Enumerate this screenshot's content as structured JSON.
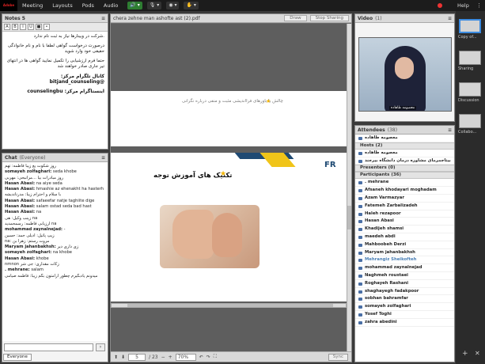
{
  "topbar": {
    "logo": "Adobe",
    "menus": [
      "Meeting",
      "Layouts",
      "Pods",
      "Audio"
    ],
    "help": "Help",
    "more": "⋮"
  },
  "notes": {
    "title": "Notes 5",
    "lines": [
      {
        "text": ".شرکت در وبینارها نیاز به ثبت نام ندارد",
        "bold": false
      },
      {
        "text": "درصورت درخواست گواهی لطفا با نام و نام خانوادگی حقیقی خود وارد شوید",
        "bold": false
      },
      {
        "text": "حتما فرم ارزشیابی را تکمیل نمایید گواهی ها در انتهای تیر جاری صادر خواهند شد",
        "bold": false
      },
      {
        "text": "کانال تلگرام مرکز: @bitjand_counseling",
        "bold": true
      },
      {
        "text": "اینستاگرام مرکز: counselingbu",
        "bold": true
      }
    ]
  },
  "chat": {
    "title": "Chat",
    "sub": "(Everyone)",
    "messages": [
      {
        "name": "",
        "text": "روز شکوت یع زیبا فاطمه: تهم"
      },
      {
        "name": "somayeh zolfaghari:",
        "text": "seda khobe"
      },
      {
        "name": "",
        "text": "روز مبادرات بیا ...مرانبحی: مهربی"
      },
      {
        "name": "Hasan Abasi:",
        "text": "na aiye seda"
      },
      {
        "name": "Hasan Abasi:",
        "text": "hmashie az ehenakht ha hasterh"
      },
      {
        "name": "",
        "text": "با سلام و احترام زیبا: مدرناندیشه"
      },
      {
        "name": "Hasan Abasi:",
        "text": "safaeefar natje taghiite dige"
      },
      {
        "name": "Hasan Abasi:",
        "text": "salam ostad seda bad hast"
      },
      {
        "name": "Hasan Abasi:",
        "text": "na"
      },
      {
        "name": "",
        "text": "زینب وکیل: هی na"
      },
      {
        "name": "",
        "text": "ارزیابی فاطمه: رسمحمدید na"
      },
      {
        "name": "mohammad zaynalnejad:",
        "text": "-"
      },
      {
        "name": "",
        "text": "زیپ پاتیل: ادیلی جمد: حسین"
      },
      {
        "name": "",
        "text": "na: مروت رستم: زهرا بن"
      },
      {
        "name": "Maryam jahanbakhsh:",
        "text": "زی داری دیر"
      },
      {
        "name": "somayeh zolfaghari:",
        "text": "na khobe"
      },
      {
        "name": "Hasan Abasi:",
        "text": "khobe"
      },
      {
        "name": "",
        "text": "nmnon زکات مقداری: جی شر"
      },
      {
        "name": ". mehrane:",
        "text": "salam"
      },
      {
        "name": "",
        "text": "میدونم یادبگیرم چطور آرامتون بگم زیبا: فاطمه صیامی"
      }
    ],
    "send": "›",
    "tab": "Everyone"
  },
  "share": {
    "title": "chera zehne man ashofte ast (2).pdf",
    "draw_label": "Draw",
    "stop_label": "Stop Sharing",
    "slide1_caption": "چالش با باورهای فرااندیشی مثبت و منفی درباره نگرانی",
    "slide2_title": "تکنیک های آموزش توجه",
    "slide2_logo": "FR",
    "page_current": "5",
    "page_total": "/ 23",
    "zoom": "70%",
    "sync": "Sync"
  },
  "video": {
    "title": "Video",
    "sub": "(1)",
    "caption": "معصومه طاهاده"
  },
  "attendees": {
    "title": "Attendees",
    "sub": "(38)",
    "active_speaker": "معصومه طاهاده",
    "hosts_label": "Hosts (2)",
    "hosts": [
      "معصومه طاهاده",
      "بیتاجمرمای مشاوره درمان دانشگاه بیرجند"
    ],
    "presenters_label": "Presenters (0)",
    "participants_label": "Participants (36)",
    "participants": [
      {
        "name": ". mehrane",
        "blue": false
      },
      {
        "name": "Afsaneh khodayari moghadam",
        "blue": false
      },
      {
        "name": "Azam Varmazyar",
        "blue": false
      },
      {
        "name": "Fatemeh Zarbalizadeh",
        "blue": false
      },
      {
        "name": "Haleh rezapoor",
        "blue": false
      },
      {
        "name": "Hasan Abasi",
        "blue": false
      },
      {
        "name": "Khadijeh shamsi",
        "blue": false
      },
      {
        "name": "maedeh abdi",
        "blue": false
      },
      {
        "name": "Mahboobeh Derzi",
        "blue": false
      },
      {
        "name": "Maryam jahanbakhsh",
        "blue": false
      },
      {
        "name": "Mehrangiz Sheikofteh",
        "blue": true
      },
      {
        "name": "mohammad zaynalnejad",
        "blue": false
      },
      {
        "name": "Naghmeh roustaei",
        "blue": false
      },
      {
        "name": "Roghayeh Rashani",
        "blue": false
      },
      {
        "name": "shaghayegh fadakpoor",
        "blue": false
      },
      {
        "name": "sobhan bahramfar",
        "blue": false
      },
      {
        "name": "somayeh zolfaghari",
        "blue": false
      },
      {
        "name": "Yosef Toghi",
        "blue": false
      },
      {
        "name": "zahra abedini",
        "blue": false
      }
    ]
  },
  "rail": {
    "items": [
      {
        "label": "Copy of..."
      },
      {
        "label": "Sharing"
      },
      {
        "label": "Discussion"
      },
      {
        "label": "Collabo..."
      }
    ]
  }
}
